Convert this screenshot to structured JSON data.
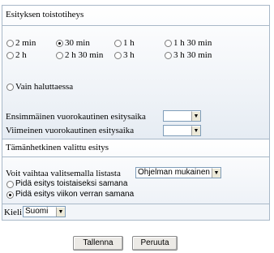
{
  "repeat_section": {
    "title": "Esityksen toistotiheys",
    "options": [
      "2 min",
      "30 min",
      "1 h",
      "1 h 30 min",
      "2 h",
      "2 h 30 min",
      "3 h",
      "3 h 30 min"
    ],
    "selected": "30 min",
    "on_request_label": "Vain haluttaessa",
    "first_time_label": "Ensimmäinen vuorokautinen esitysaika",
    "first_time_value": "",
    "last_time_label": "Viimeinen vuorokautinen esitysaika",
    "last_time_value": ""
  },
  "current_section": {
    "title": "Tämänhetkinen valittu esitys",
    "change_label": "Voit vaihtaa valitsemalla listasta",
    "program_select_value": "Ohjelman mukainen",
    "keep_until_further_label": "Pidä esitys toistaiseksi samana",
    "keep_week_label": "Pidä esitys viikon verran samana",
    "keep_selected": "week"
  },
  "language": {
    "label": "Kieli",
    "value": "Suomi"
  },
  "buttons": {
    "save": "Tallenna",
    "cancel": "Peruuta"
  }
}
